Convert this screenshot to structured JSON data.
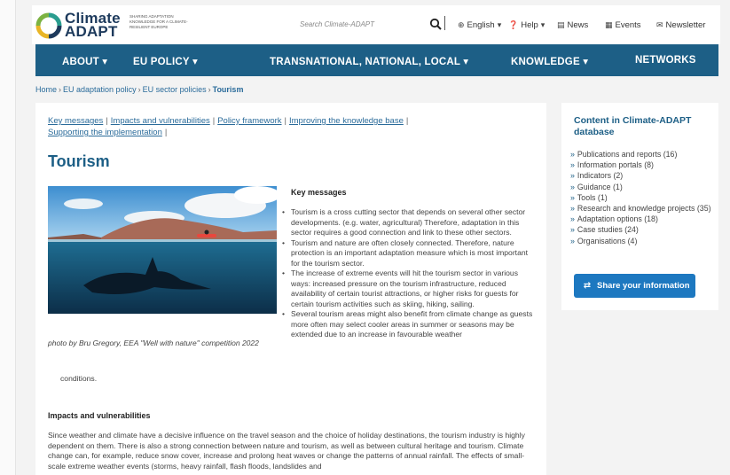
{
  "logo": {
    "line1": "Climate",
    "line2": "ADAPT",
    "tagline": "SHARING ADAPTATION KNOWLEDGE FOR A CLIMATE-RESILIENT EUROPE"
  },
  "search": {
    "placeholder": "Search Climate-ADAPT"
  },
  "topmenu": {
    "language": "English",
    "help": "Help",
    "news": "News",
    "events": "Events",
    "newsletter": "Newsletter"
  },
  "nav": [
    "ABOUT",
    "EU POLICY",
    "TRANSNATIONAL, NATIONAL, LOCAL",
    "KNOWLEDGE",
    "NETWORKS"
  ],
  "breadcrumb": [
    "Home",
    "EU adaptation policy",
    "EU sector policies",
    "Tourism"
  ],
  "page_links": [
    "Key messages",
    "Impacts and vulnerabilities",
    "Policy framework",
    "Improving the knowledge base",
    "Supporting the implementation"
  ],
  "title": "Tourism",
  "caption": "photo by Bru Gregory, EEA \"Well with nature\" competition 2022",
  "key_messages": {
    "heading": "Key messages",
    "items": [
      "Tourism is a cross cutting sector that depends on several other sector developments. (e.g. water, agricultural) Therefore, adaptation in this sector requires a good connection and link to these other sectors.",
      "Tourism and nature are often closely connected. Therefore, nature protection is an important adaptation measure which is most important for the tourism sector.",
      "The increase of extreme events will hit the tourism sector in various ways: increased pressure on the tourism infrastructure, reduced availability of certain tourist attractions, or higher risks for guests for certain tourism activities such as skiing, hiking, sailing.",
      "Several tourism areas might also benefit from climate change as guests more often may select cooler areas in summer or seasons may be extended due to an increase in favourable weather"
    ],
    "continuation": "conditions."
  },
  "impacts": {
    "heading": "Impacts and vulnerabilities",
    "text": "Since weather and climate have a decisive influence on the travel season and the choice of holiday destinations, the tourism industry is highly dependent on them. There is also a strong connection between nature and tourism, as well as between cultural heritage and tourism. Climate change can, for example, reduce snow cover, increase and prolong heat waves or change the patterns of annual rainfall. The effects of small-scale extreme weather events (storms, heavy rainfall, flash floods, landslides and"
  },
  "sidebar": {
    "title": "Content in Climate-ADAPT database",
    "items": [
      "Publications and reports (16)",
      "Information portals (8)",
      "Indicators (2)",
      "Guidance (1)",
      "Tools (1)",
      "Research and knowledge projects (35)",
      "Adaptation options (18)",
      "Case studies (24)",
      "Organisations (4)"
    ],
    "share_label": "Share your information"
  },
  "colors": {
    "nav_bg": "#1d5f86",
    "link": "#2a6b9a",
    "button": "#1d78c0"
  }
}
